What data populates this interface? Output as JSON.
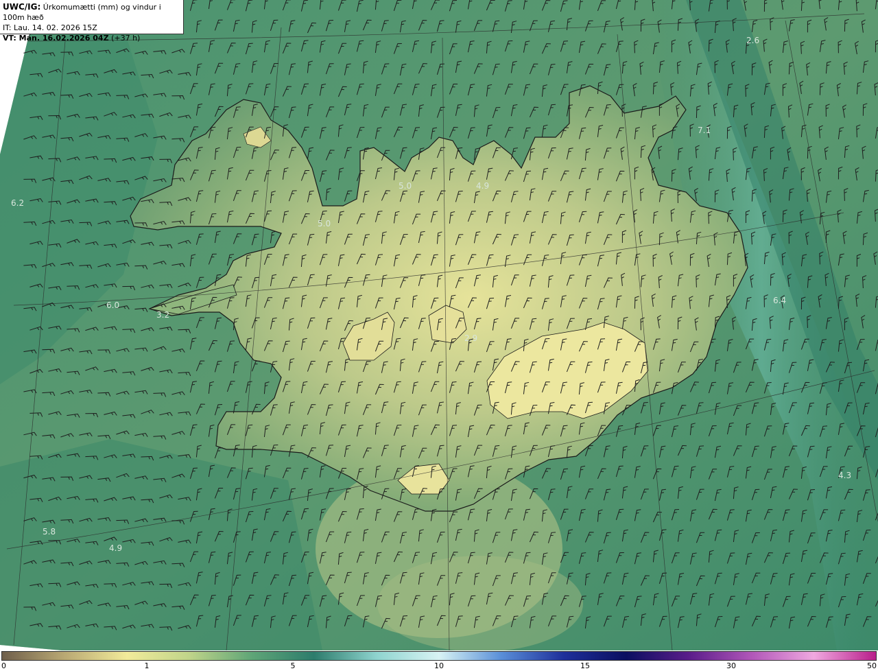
{
  "header": {
    "model": "UWC/IG:",
    "field": "Úrkomumætti (mm) og vindur i 100m hæð",
    "initial_time": "IT: Lau. 14. 02. 2026 15Z",
    "valid_prefix": "VT: ",
    "valid_time": "Mán. 16.02.2026 04Z",
    "valid_suffix": " (+37 h)"
  },
  "map_values": [
    {
      "label": "2.6"
    },
    {
      "label": "7.1"
    },
    {
      "label": "6.2"
    },
    {
      "label": "5.0"
    },
    {
      "label": "4.9"
    },
    {
      "label": "5.0"
    },
    {
      "label": "6.0"
    },
    {
      "label": "3.2"
    },
    {
      "label": "6.4"
    },
    {
      "label": "4.3"
    },
    {
      "label": "5.8"
    },
    {
      "label": "4.9"
    },
    {
      "label": "2.9"
    }
  ],
  "colorbar": {
    "ticks": [
      "0",
      "1",
      "5",
      "10",
      "15",
      "30",
      "50"
    ],
    "colors": [
      "#6f5f4b",
      "#b9a873",
      "#f2eb9a",
      "#c0d48a",
      "#5fa577",
      "#2d7c6c",
      "#8fd4cf",
      "#d8f3f4",
      "#5a8fd8",
      "#1e2f9a",
      "#0b0f60",
      "#5a1d8a",
      "#b056b8",
      "#f0a8e0",
      "#b81e8a"
    ]
  },
  "colors": {
    "sea_dark": "#2e7b63",
    "sea_mid": "#4f9470",
    "land_low": "#6fa373",
    "land_high": "#dede93",
    "coast": "#1a1a1a"
  }
}
